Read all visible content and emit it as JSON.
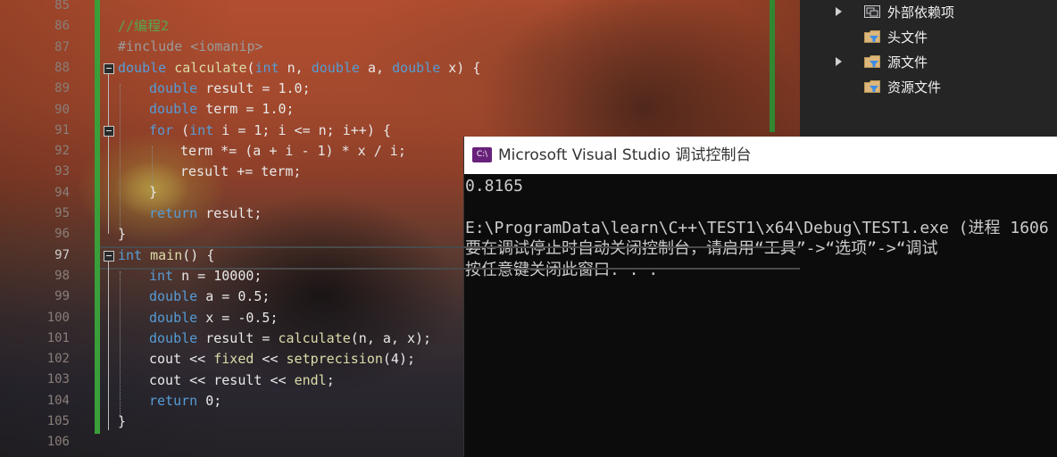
{
  "editor": {
    "line_numbers": [
      "85",
      "86",
      "87",
      "88",
      "89",
      "90",
      "91",
      "92",
      "93",
      "94",
      "95",
      "96",
      "97",
      "98",
      "99",
      "100",
      "101",
      "102",
      "103",
      "104",
      "105",
      "106"
    ],
    "current_line": "97",
    "code": {
      "l86_comment": "//编程2",
      "l87_include": "#include <iomanip>",
      "l88": {
        "t1": "double",
        "t2": " ",
        "t3": "calculate",
        "t4": "(",
        "t5": "int",
        "t6": " n, ",
        "t7": "double",
        "t8": " a, ",
        "t9": "double",
        "t10": " x) {"
      },
      "l89": {
        "t1": "double",
        "t2": " result = 1.0;"
      },
      "l90": {
        "t1": "double",
        "t2": " term = 1.0;"
      },
      "l91": {
        "t1": "for",
        "t2": " (",
        "t3": "int",
        "t4": " i = 1; i <= n; i++) {"
      },
      "l92": "term *= (a + i - 1) * x / i;",
      "l93": "result += term;",
      "l94": "}",
      "l95": {
        "t1": "return",
        "t2": " result;"
      },
      "l96": "}",
      "l97": {
        "t1": "int",
        "t2": " ",
        "t3": "main",
        "t4": "() {"
      },
      "l98": {
        "t1": "int",
        "t2": " n = 10000;"
      },
      "l99": {
        "t1": "double",
        "t2": " a = 0.5;"
      },
      "l100": {
        "t1": "double",
        "t2": " x = -0.5;"
      },
      "l101": {
        "t1": "double",
        "t2": " result = ",
        "t3": "calculate",
        "t4": "(n, a, x);"
      },
      "l102": {
        "t1": "cout << ",
        "t2": "fixed",
        "t3": " << ",
        "t4": "setprecision",
        "t5": "(4);"
      },
      "l103": {
        "t1": "cout << ",
        "t2": "result",
        "t3": " << ",
        "t4": "endl",
        "t5": ";"
      },
      "l104": {
        "t1": "return",
        "t2": " 0;"
      },
      "l105": "}"
    }
  },
  "solution_explorer": {
    "items": [
      {
        "label": "外部依赖项",
        "icon": "external-deps-icon",
        "expandable": true
      },
      {
        "label": "头文件",
        "icon": "filter-folder-icon",
        "expandable": false
      },
      {
        "label": "源文件",
        "icon": "filter-folder-icon",
        "expandable": true
      },
      {
        "label": "资源文件",
        "icon": "filter-folder-icon",
        "expandable": false
      }
    ]
  },
  "console": {
    "icon_text": "C:\\",
    "title": "Microsoft Visual Studio 调试控制台",
    "lines": [
      "0.8165",
      "",
      "E:\\ProgramData\\learn\\C++\\TEST1\\x64\\Debug\\TEST1.exe (进程 1606",
      "要在调试停止时自动关闭控制台，请启用“工具”->“选项”->“调试",
      "按任意键关闭此窗口. . ."
    ]
  },
  "colors": {
    "keyword": "#569cd6",
    "function": "#dcdcaa",
    "comment": "#57a64a",
    "green_margin": "#3fae3f",
    "console_bg": "#0c0c0c",
    "vs_purple": "#68217a"
  }
}
